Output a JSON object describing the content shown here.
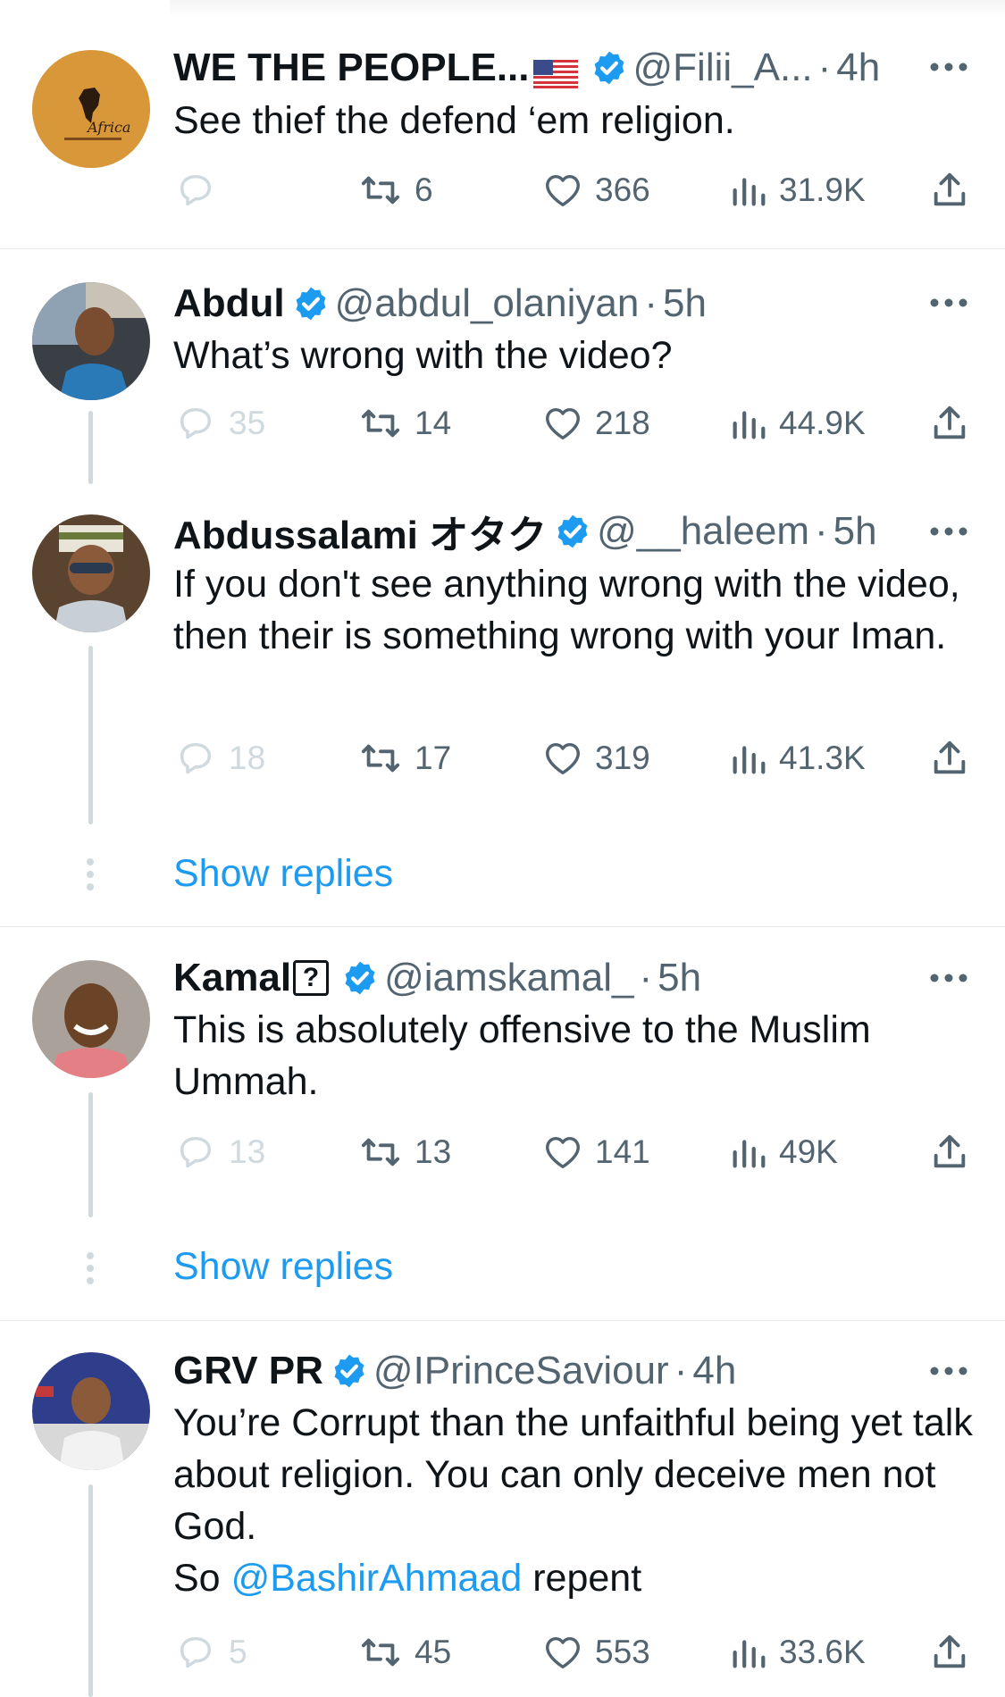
{
  "colors": {
    "accent": "#1d9bf0",
    "text": "#0f1419",
    "muted": "#536471",
    "faint": "#cfd9de",
    "divider": "#e6e9eb"
  },
  "tweets": [
    {
      "name": "WE THE PEOPLE...",
      "flag": "us-flag-emoji",
      "handle": "@Filii_A...",
      "time": "4h",
      "text": "See thief the defend ‘em religion.",
      "replies": "",
      "retweets": "6",
      "likes": "366",
      "views": "31.9K",
      "avatar_text": "Africa"
    },
    {
      "name": "Abdul",
      "handle": "@abdul_olaniyan",
      "time": "5h",
      "text": "What’s wrong with the video?",
      "replies": "35",
      "retweets": "14",
      "likes": "218",
      "views": "44.9K"
    },
    {
      "name": "Abdussalami オタク",
      "handle": "@__haleem",
      "time": "5h",
      "text": "If you don't see anything wrong with the video, then their is something wrong with your Iman.",
      "replies": "18",
      "retweets": "17",
      "likes": "319",
      "views": "41.3K"
    },
    {
      "name": "Kamal",
      "name_badge": "?",
      "handle": "@iamskamal_",
      "time": "5h",
      "text": "This is absolutely offensive to the Muslim Ummah.",
      "replies": "13",
      "retweets": "13",
      "likes": "141",
      "views": "49K"
    },
    {
      "name": "GRV PR",
      "handle": "@IPrinceSaviour",
      "time": "4h",
      "text_main": "You’re Corrupt than the unfaithful being yet talk about religion. You can only deceive men not God.",
      "text_so": "So",
      "text_mention": "@BashirAhmaad",
      "text_tail": "repent",
      "replies": "5",
      "retweets": "45",
      "likes": "553",
      "views": "33.6K"
    }
  ],
  "show_replies_label": "Show replies",
  "separator": "·",
  "icons": [
    "verified-badge-icon",
    "more-options-icon",
    "reply-icon",
    "retweet-icon",
    "like-icon",
    "views-icon",
    "share-icon"
  ]
}
